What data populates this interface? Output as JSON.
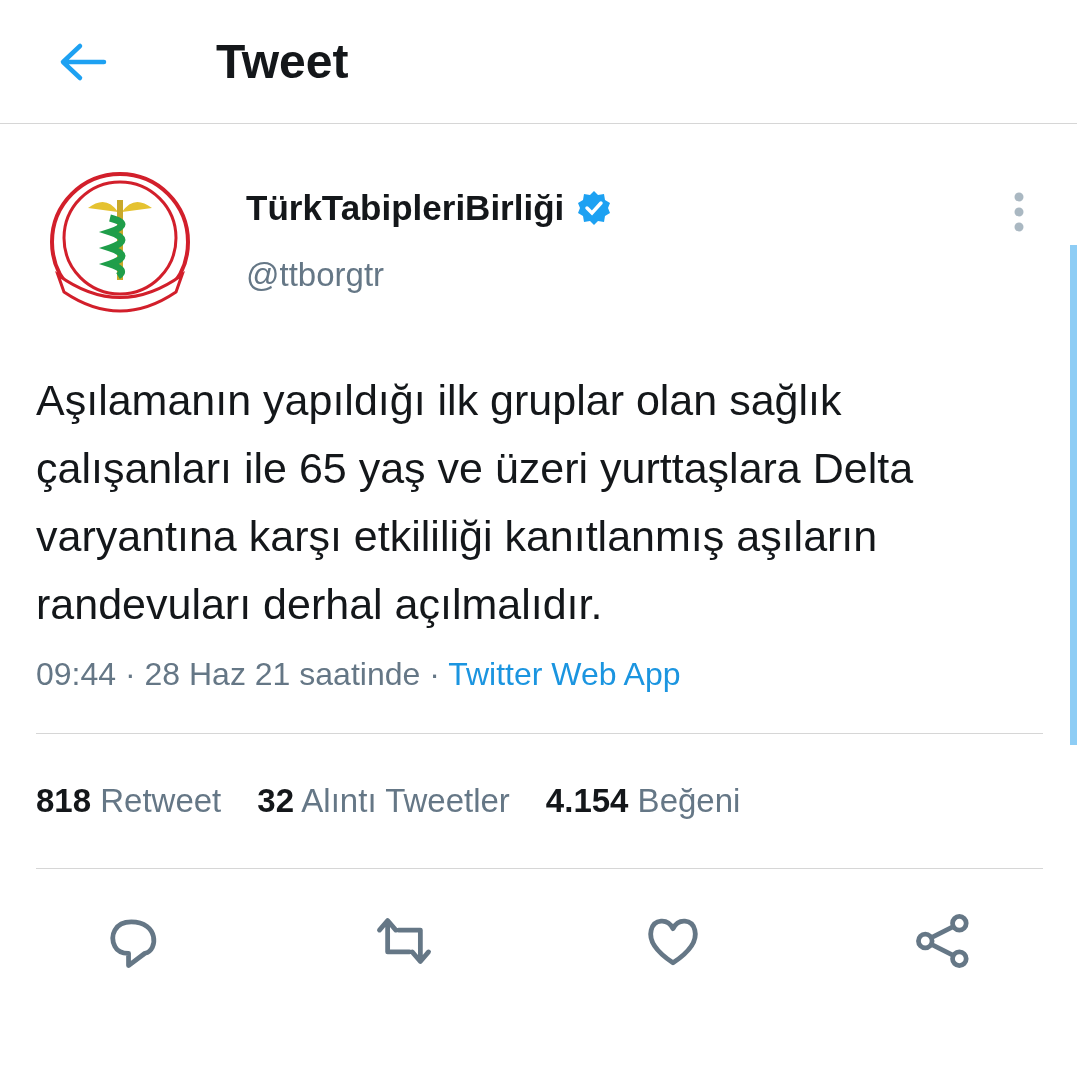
{
  "header": {
    "title": "Tweet"
  },
  "tweet": {
    "author": {
      "name": "TürkTabipleriBirliği",
      "verified": true,
      "handle": "@ttborgtr"
    },
    "text": "Aşılamanın yapıldığı ilk gruplar olan sağlık çalışanları ile 65 yaş ve üzeri yurttaşlara Delta varyantına karşı etkililiği kanıtlanmış aşıların randevuları derhal açılmalıdır.",
    "timestamp": "09:44 · 28 Haz 21 saatinde ·",
    "source": "Twitter Web App",
    "stats": [
      {
        "text": "**818** Retweet"
      },
      {
        "text": "**32** Alıntı Tweetler"
      },
      {
        "text": "**4.154** Beğeni"
      }
    ],
    "actions": [
      {
        "kind": "reply"
      },
      {
        "kind": "retweet"
      },
      {
        "kind": "like"
      },
      {
        "kind": "share"
      }
    ]
  }
}
